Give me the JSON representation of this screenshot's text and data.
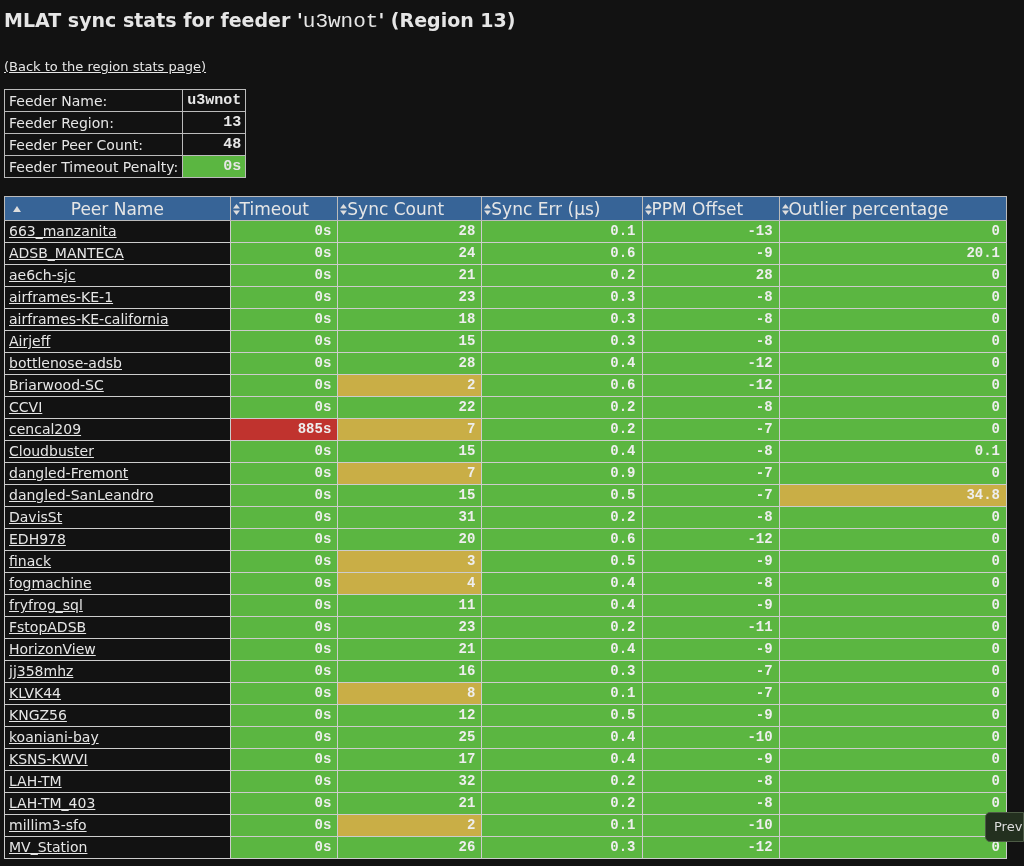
{
  "title": {
    "before": "MLAT sync stats for feeder '",
    "feeder": "u3wnot",
    "after": "' (Region 13)"
  },
  "back_link": "(Back to the region stats page)",
  "feeder_info": [
    {
      "label": "Feeder Name:",
      "value": "u3wnot"
    },
    {
      "label": "Feeder Region:",
      "value": "13"
    },
    {
      "label": "Feeder Peer Count:",
      "value": "48"
    },
    {
      "label": "Feeder Timeout Penalty:",
      "value": "0s",
      "color": "#5bb641"
    }
  ],
  "table": {
    "columns": [
      {
        "label": "Peer Name",
        "sorted": true
      },
      {
        "label": "Timeout",
        "sorted": false
      },
      {
        "label": "Sync Count",
        "sorted": false
      },
      {
        "label": "Sync Err (µs)",
        "sorted": false
      },
      {
        "label": "PPM Offset",
        "sorted": false
      },
      {
        "label": "Outlier percentage",
        "sorted": false
      }
    ],
    "rows": [
      {
        "cells": [
          {
            "text": "663_manzanita"
          },
          {
            "text": "0s",
            "color": "#5bb641"
          },
          {
            "text": "28",
            "color": "#5bb641"
          },
          {
            "text": "0.1",
            "color": "#5bb641"
          },
          {
            "text": "-13",
            "color": "#5bb641"
          },
          {
            "text": "0",
            "color": "#5bb641"
          }
        ]
      },
      {
        "cells": [
          {
            "text": "ADSB_MANTECA"
          },
          {
            "text": "0s",
            "color": "#5bb641"
          },
          {
            "text": "24",
            "color": "#5bb641"
          },
          {
            "text": "0.6",
            "color": "#5bb641"
          },
          {
            "text": "-9",
            "color": "#5bb641"
          },
          {
            "text": "20.1",
            "color": "#5bb641"
          }
        ]
      },
      {
        "cells": [
          {
            "text": "ae6ch-sjc"
          },
          {
            "text": "0s",
            "color": "#5bb641"
          },
          {
            "text": "21",
            "color": "#5bb641"
          },
          {
            "text": "0.2",
            "color": "#5bb641"
          },
          {
            "text": "28",
            "color": "#5bb641"
          },
          {
            "text": "0",
            "color": "#5bb641"
          }
        ]
      },
      {
        "cells": [
          {
            "text": "airframes-KE-1"
          },
          {
            "text": "0s",
            "color": "#5bb641"
          },
          {
            "text": "23",
            "color": "#5bb641"
          },
          {
            "text": "0.3",
            "color": "#5bb641"
          },
          {
            "text": "-8",
            "color": "#5bb641"
          },
          {
            "text": "0",
            "color": "#5bb641"
          }
        ]
      },
      {
        "cells": [
          {
            "text": "airframes-KE-california"
          },
          {
            "text": "0s",
            "color": "#5bb641"
          },
          {
            "text": "18",
            "color": "#5bb641"
          },
          {
            "text": "0.3",
            "color": "#5bb641"
          },
          {
            "text": "-8",
            "color": "#5bb641"
          },
          {
            "text": "0",
            "color": "#5bb641"
          }
        ]
      },
      {
        "cells": [
          {
            "text": "Airjeff"
          },
          {
            "text": "0s",
            "color": "#5bb641"
          },
          {
            "text": "15",
            "color": "#5bb641"
          },
          {
            "text": "0.3",
            "color": "#5bb641"
          },
          {
            "text": "-8",
            "color": "#5bb641"
          },
          {
            "text": "0",
            "color": "#5bb641"
          }
        ]
      },
      {
        "cells": [
          {
            "text": "bottlenose-adsb"
          },
          {
            "text": "0s",
            "color": "#5bb641"
          },
          {
            "text": "28",
            "color": "#5bb641"
          },
          {
            "text": "0.4",
            "color": "#5bb641"
          },
          {
            "text": "-12",
            "color": "#5bb641"
          },
          {
            "text": "0",
            "color": "#5bb641"
          }
        ]
      },
      {
        "cells": [
          {
            "text": "Briarwood-SC"
          },
          {
            "text": "0s",
            "color": "#5bb641"
          },
          {
            "text": "2",
            "color": "#c9ae46"
          },
          {
            "text": "0.6",
            "color": "#5bb641"
          },
          {
            "text": "-12",
            "color": "#5bb641"
          },
          {
            "text": "0",
            "color": "#5bb641"
          }
        ]
      },
      {
        "cells": [
          {
            "text": "CCVI"
          },
          {
            "text": "0s",
            "color": "#5bb641"
          },
          {
            "text": "22",
            "color": "#5bb641"
          },
          {
            "text": "0.2",
            "color": "#5bb641"
          },
          {
            "text": "-8",
            "color": "#5bb641"
          },
          {
            "text": "0",
            "color": "#5bb641"
          }
        ]
      },
      {
        "cells": [
          {
            "text": "cencal209"
          },
          {
            "text": "885s",
            "color": "#c0332e"
          },
          {
            "text": "7",
            "color": "#c9ae46"
          },
          {
            "text": "0.2",
            "color": "#5bb641"
          },
          {
            "text": "-7",
            "color": "#5bb641"
          },
          {
            "text": "0",
            "color": "#5bb641"
          }
        ]
      },
      {
        "cells": [
          {
            "text": "Cloudbuster"
          },
          {
            "text": "0s",
            "color": "#5bb641"
          },
          {
            "text": "15",
            "color": "#5bb641"
          },
          {
            "text": "0.4",
            "color": "#5bb641"
          },
          {
            "text": "-8",
            "color": "#5bb641"
          },
          {
            "text": "0.1",
            "color": "#5bb641"
          }
        ]
      },
      {
        "cells": [
          {
            "text": "dangled-Fremont"
          },
          {
            "text": "0s",
            "color": "#5bb641"
          },
          {
            "text": "7",
            "color": "#c9ae46"
          },
          {
            "text": "0.9",
            "color": "#5bb641"
          },
          {
            "text": "-7",
            "color": "#5bb641"
          },
          {
            "text": "0",
            "color": "#5bb641"
          }
        ]
      },
      {
        "cells": [
          {
            "text": "dangled-SanLeandro"
          },
          {
            "text": "0s",
            "color": "#5bb641"
          },
          {
            "text": "15",
            "color": "#5bb641"
          },
          {
            "text": "0.5",
            "color": "#5bb641"
          },
          {
            "text": "-7",
            "color": "#5bb641"
          },
          {
            "text": "34.8",
            "color": "#c9ae46"
          }
        ]
      },
      {
        "cells": [
          {
            "text": "DavisSt"
          },
          {
            "text": "0s",
            "color": "#5bb641"
          },
          {
            "text": "31",
            "color": "#5bb641"
          },
          {
            "text": "0.2",
            "color": "#5bb641"
          },
          {
            "text": "-8",
            "color": "#5bb641"
          },
          {
            "text": "0",
            "color": "#5bb641"
          }
        ]
      },
      {
        "cells": [
          {
            "text": "EDH978"
          },
          {
            "text": "0s",
            "color": "#5bb641"
          },
          {
            "text": "20",
            "color": "#5bb641"
          },
          {
            "text": "0.6",
            "color": "#5bb641"
          },
          {
            "text": "-12",
            "color": "#5bb641"
          },
          {
            "text": "0",
            "color": "#5bb641"
          }
        ]
      },
      {
        "cells": [
          {
            "text": "finack"
          },
          {
            "text": "0s",
            "color": "#5bb641"
          },
          {
            "text": "3",
            "color": "#c9ae46"
          },
          {
            "text": "0.5",
            "color": "#5bb641"
          },
          {
            "text": "-9",
            "color": "#5bb641"
          },
          {
            "text": "0",
            "color": "#5bb641"
          }
        ]
      },
      {
        "cells": [
          {
            "text": "fogmachine"
          },
          {
            "text": "0s",
            "color": "#5bb641"
          },
          {
            "text": "4",
            "color": "#c9ae46"
          },
          {
            "text": "0.4",
            "color": "#5bb641"
          },
          {
            "text": "-8",
            "color": "#5bb641"
          },
          {
            "text": "0",
            "color": "#5bb641"
          }
        ]
      },
      {
        "cells": [
          {
            "text": "fryfrog_sql"
          },
          {
            "text": "0s",
            "color": "#5bb641"
          },
          {
            "text": "11",
            "color": "#5bb641"
          },
          {
            "text": "0.4",
            "color": "#5bb641"
          },
          {
            "text": "-9",
            "color": "#5bb641"
          },
          {
            "text": "0",
            "color": "#5bb641"
          }
        ]
      },
      {
        "cells": [
          {
            "text": "FstopADSB"
          },
          {
            "text": "0s",
            "color": "#5bb641"
          },
          {
            "text": "23",
            "color": "#5bb641"
          },
          {
            "text": "0.2",
            "color": "#5bb641"
          },
          {
            "text": "-11",
            "color": "#5bb641"
          },
          {
            "text": "0",
            "color": "#5bb641"
          }
        ]
      },
      {
        "cells": [
          {
            "text": "HorizonView"
          },
          {
            "text": "0s",
            "color": "#5bb641"
          },
          {
            "text": "21",
            "color": "#5bb641"
          },
          {
            "text": "0.4",
            "color": "#5bb641"
          },
          {
            "text": "-9",
            "color": "#5bb641"
          },
          {
            "text": "0",
            "color": "#5bb641"
          }
        ]
      },
      {
        "cells": [
          {
            "text": "jj358mhz"
          },
          {
            "text": "0s",
            "color": "#5bb641"
          },
          {
            "text": "16",
            "color": "#5bb641"
          },
          {
            "text": "0.3",
            "color": "#5bb641"
          },
          {
            "text": "-7",
            "color": "#5bb641"
          },
          {
            "text": "0",
            "color": "#5bb641"
          }
        ]
      },
      {
        "cells": [
          {
            "text": "KLVK44"
          },
          {
            "text": "0s",
            "color": "#5bb641"
          },
          {
            "text": "8",
            "color": "#c9ae46"
          },
          {
            "text": "0.1",
            "color": "#5bb641"
          },
          {
            "text": "-7",
            "color": "#5bb641"
          },
          {
            "text": "0",
            "color": "#5bb641"
          }
        ]
      },
      {
        "cells": [
          {
            "text": "KNGZ56"
          },
          {
            "text": "0s",
            "color": "#5bb641"
          },
          {
            "text": "12",
            "color": "#5bb641"
          },
          {
            "text": "0.5",
            "color": "#5bb641"
          },
          {
            "text": "-9",
            "color": "#5bb641"
          },
          {
            "text": "0",
            "color": "#5bb641"
          }
        ]
      },
      {
        "cells": [
          {
            "text": "koaniani-bay"
          },
          {
            "text": "0s",
            "color": "#5bb641"
          },
          {
            "text": "25",
            "color": "#5bb641"
          },
          {
            "text": "0.4",
            "color": "#5bb641"
          },
          {
            "text": "-10",
            "color": "#5bb641"
          },
          {
            "text": "0",
            "color": "#5bb641"
          }
        ]
      },
      {
        "cells": [
          {
            "text": "KSNS-KWVI"
          },
          {
            "text": "0s",
            "color": "#5bb641"
          },
          {
            "text": "17",
            "color": "#5bb641"
          },
          {
            "text": "0.4",
            "color": "#5bb641"
          },
          {
            "text": "-9",
            "color": "#5bb641"
          },
          {
            "text": "0",
            "color": "#5bb641"
          }
        ]
      },
      {
        "cells": [
          {
            "text": "LAH-TM"
          },
          {
            "text": "0s",
            "color": "#5bb641"
          },
          {
            "text": "32",
            "color": "#5bb641"
          },
          {
            "text": "0.2",
            "color": "#5bb641"
          },
          {
            "text": "-8",
            "color": "#5bb641"
          },
          {
            "text": "0",
            "color": "#5bb641"
          }
        ]
      },
      {
        "cells": [
          {
            "text": "LAH-TM_403"
          },
          {
            "text": "0s",
            "color": "#5bb641"
          },
          {
            "text": "21",
            "color": "#5bb641"
          },
          {
            "text": "0.2",
            "color": "#5bb641"
          },
          {
            "text": "-8",
            "color": "#5bb641"
          },
          {
            "text": "0",
            "color": "#5bb641"
          }
        ]
      },
      {
        "cells": [
          {
            "text": "millim3-sfo"
          },
          {
            "text": "0s",
            "color": "#5bb641"
          },
          {
            "text": "2",
            "color": "#c9ae46"
          },
          {
            "text": "0.1",
            "color": "#5bb641"
          },
          {
            "text": "-10",
            "color": "#5bb641"
          },
          {
            "color": "#5bb641"
          }
        ]
      },
      {
        "cells": [
          {
            "text": "MV_Station"
          },
          {
            "text": "0s",
            "color": "#5bb641"
          },
          {
            "text": "26",
            "color": "#5bb641"
          },
          {
            "text": "0.3",
            "color": "#5bb641"
          },
          {
            "text": "-12",
            "color": "#5bb641"
          },
          {
            "text": "0",
            "color": "#5bb641"
          }
        ]
      }
    ]
  },
  "tooltip": "Prev"
}
